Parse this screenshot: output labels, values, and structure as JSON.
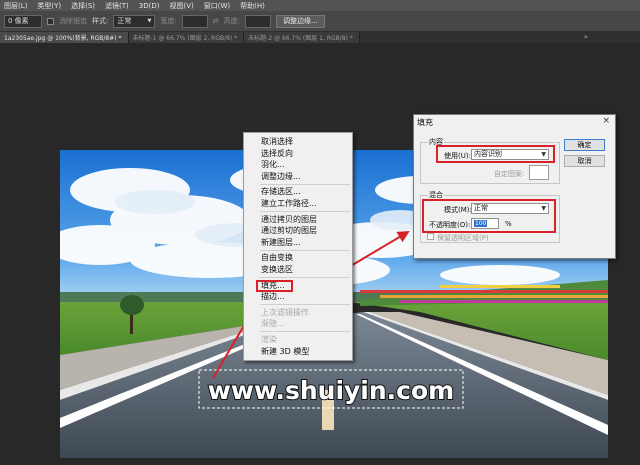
{
  "menubar": {
    "items": [
      "图层(L)",
      "类型(Y)",
      "选择(S)",
      "滤镜(T)",
      "3D(D)",
      "视图(V)",
      "窗口(W)",
      "帮助(H)"
    ]
  },
  "options": {
    "feather": "0 像素",
    "antialias_label": "消除锯齿",
    "style_label": "样式:",
    "style_value": "正常",
    "width_label": "宽度:",
    "height_label": "高度:",
    "refine_button": "调整边缘..."
  },
  "tabs": [
    {
      "label": "1a2305ae.jpg @ 100%(背景, RGB/8#) *",
      "active": true
    },
    {
      "label": "未标题-1 @ 66.7% (图层 2, RGB/8) *",
      "active": false
    },
    {
      "label": "未标题-2 @ 66.7% (图层 1, RGB/8) *",
      "active": false
    }
  ],
  "tab_more": "»",
  "context_menu": {
    "items": [
      {
        "label": "取消选择",
        "disabled": false
      },
      {
        "label": "选择反向",
        "disabled": false
      },
      {
        "label": "羽化...",
        "disabled": false
      },
      {
        "label": "调整边缘...",
        "disabled": false
      },
      {
        "sep": true
      },
      {
        "label": "存储选区...",
        "disabled": false
      },
      {
        "label": "建立工作路径...",
        "disabled": false
      },
      {
        "sep": true
      },
      {
        "label": "通过拷贝的图层",
        "disabled": false
      },
      {
        "label": "通过剪切的图层",
        "disabled": false
      },
      {
        "label": "新建图层...",
        "disabled": false
      },
      {
        "sep": true
      },
      {
        "label": "自由变换",
        "disabled": false
      },
      {
        "label": "变换选区",
        "disabled": false
      },
      {
        "sep": true
      },
      {
        "label": "填充...",
        "disabled": false,
        "highlight": true
      },
      {
        "label": "描边...",
        "disabled": false
      },
      {
        "sep": true
      },
      {
        "label": "上次滤镜操作",
        "disabled": true
      },
      {
        "label": "渐隐...",
        "disabled": true
      },
      {
        "sep": true
      },
      {
        "label": "渲染",
        "disabled": true
      },
      {
        "label": "新建 3D 模型",
        "disabled": false
      }
    ]
  },
  "dialog": {
    "title": "填充",
    "close": "×",
    "content_legend": "内容",
    "use_label": "使用(U):",
    "use_value": "内容识别",
    "custom_pattern_label": "自定图案:",
    "blend_legend": "混合",
    "mode_label": "模式(M):",
    "mode_value": "正常",
    "opacity_label": "不透明度(O):",
    "opacity_value": "100",
    "opacity_unit": "%",
    "preserve_label": "保留透明区域(P)",
    "ok_button": "确定",
    "cancel_button": "取消"
  },
  "watermark_text": "www.shuiyin.com",
  "colors": {
    "annotation_red": "#d8222a",
    "menubar": "#535353",
    "options_bar": "#474747",
    "workspace": "#282828"
  }
}
